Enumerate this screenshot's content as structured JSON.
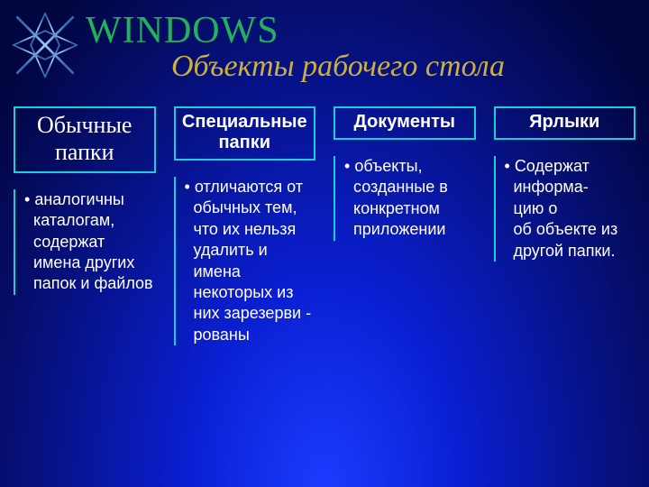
{
  "title": "WINDOWS",
  "subtitle": "Объекты рабочего стола",
  "columns": [
    {
      "header": "Обычные папки",
      "header_style": "serif",
      "body": "аналогичны каталогам, содержат имена других папок и файлов"
    },
    {
      "header": "Специальные папки",
      "header_style": "sans",
      "body": "отличаются от обычных тем, что их нельзя удалить и имена некоторых из них зарезерви -\nрованы"
    },
    {
      "header": "Документы",
      "header_style": "sans",
      "body": "объекты, созданные в конкретном приложении"
    },
    {
      "header": "Ярлыки",
      "header_style": "sans",
      "body": "Содержат информа-\nцию о\nоб объекте из другой папки."
    }
  ]
}
